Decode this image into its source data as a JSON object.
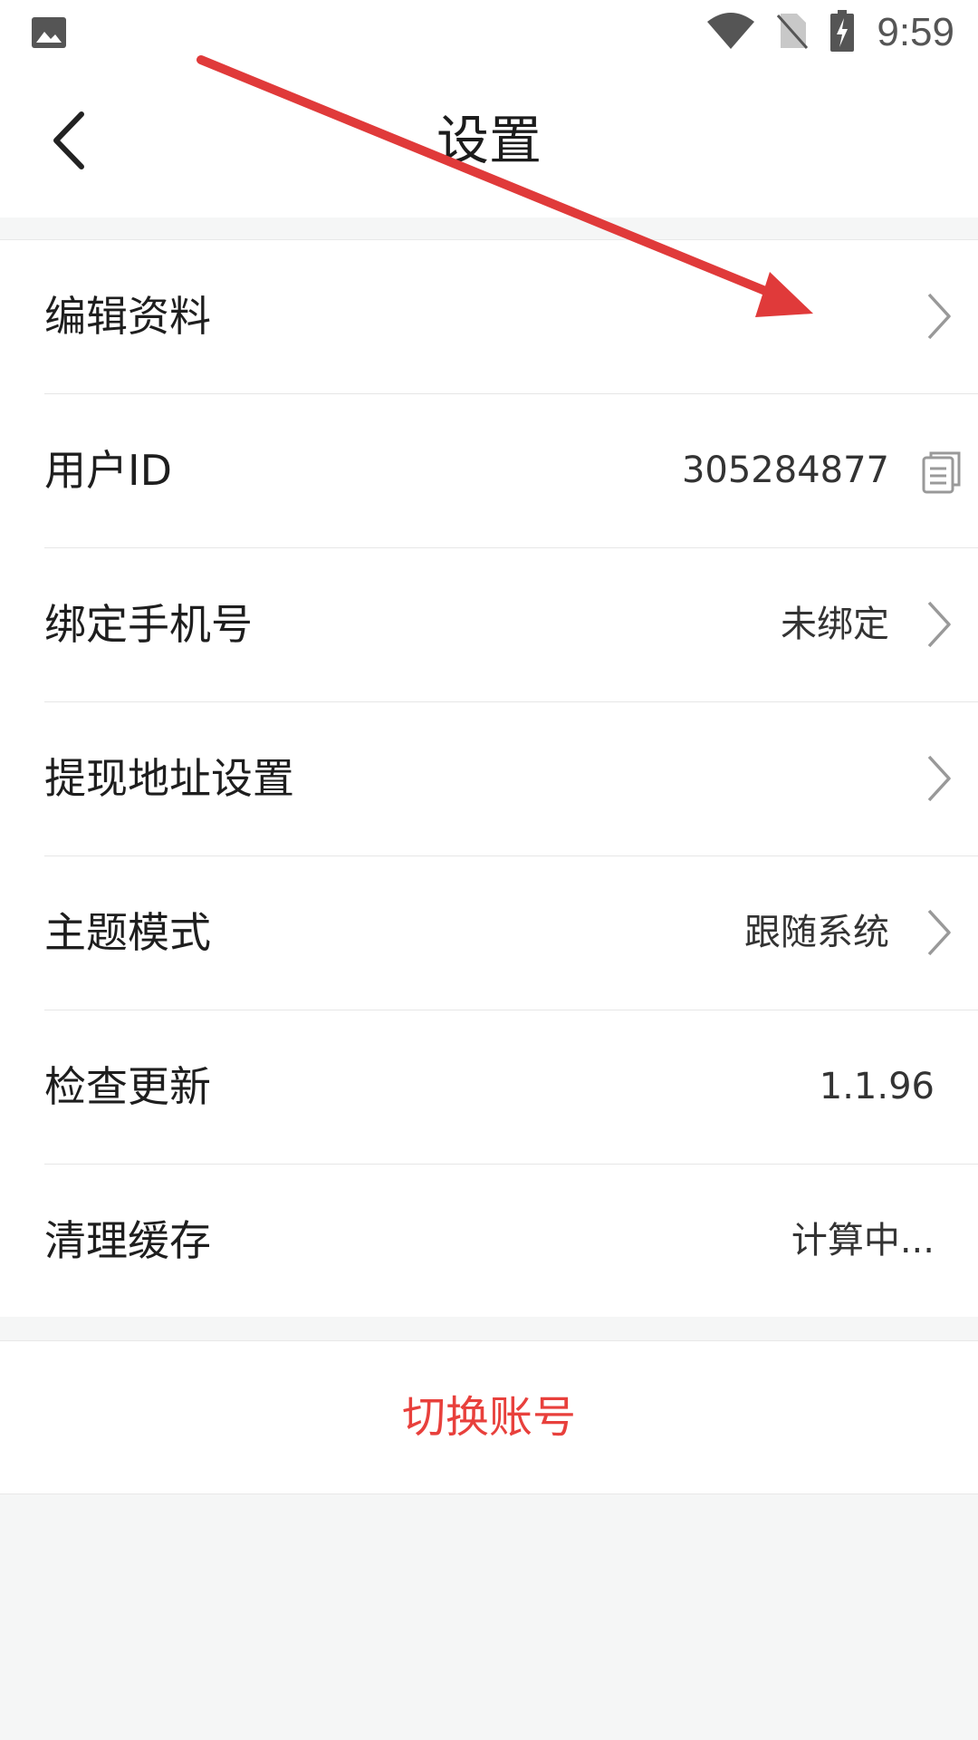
{
  "status_bar": {
    "time": "9:59",
    "icons": [
      "gallery-icon",
      "wifi-icon",
      "no-sim-icon",
      "battery-charging-icon"
    ]
  },
  "header": {
    "title": "设置",
    "back_icon": "back-arrow-icon"
  },
  "settings": {
    "items": [
      {
        "label": "编辑资料",
        "value": "",
        "chevron": true
      },
      {
        "label": "用户ID",
        "value": "305284877",
        "copy": true
      },
      {
        "label": "绑定手机号",
        "value": "未绑定",
        "chevron": true
      },
      {
        "label": "提现地址设置",
        "value": "",
        "chevron": true
      },
      {
        "label": "主题模式",
        "value": "跟随系统",
        "chevron": true
      },
      {
        "label": "检查更新",
        "value": "1.1.96",
        "chevron": false
      },
      {
        "label": "清理缓存",
        "value": "计算中...",
        "chevron": false
      }
    ]
  },
  "switch_account": {
    "label": "切换账号",
    "color": "#e8403c"
  },
  "colors": {
    "annotation_arrow": "#e03a3a",
    "background": "#f5f6f6"
  }
}
